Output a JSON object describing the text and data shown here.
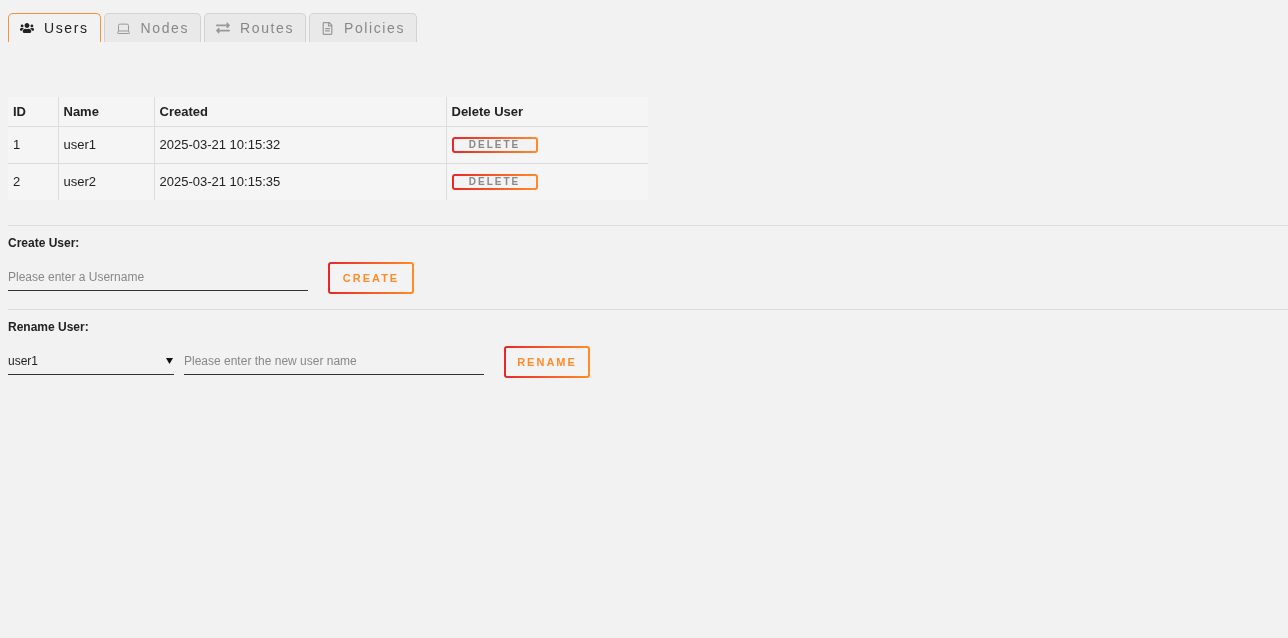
{
  "tabs": [
    {
      "label": "Users",
      "selected": true
    },
    {
      "label": "Nodes",
      "selected": false
    },
    {
      "label": "Routes",
      "selected": false
    },
    {
      "label": "Policies",
      "selected": false
    }
  ],
  "users_table": {
    "columns": [
      "ID",
      "Name",
      "Created",
      "Delete User"
    ],
    "rows": [
      {
        "id": "1",
        "name": "user1",
        "created": "2025-03-21 10:15:32",
        "delete_button": "DELETE"
      },
      {
        "id": "2",
        "name": "user2",
        "created": "2025-03-21 10:15:35",
        "delete_button": "DELETE"
      }
    ]
  },
  "create_user": {
    "label": "Create User:",
    "placeholder": "Please enter a Username",
    "button": "CREATE"
  },
  "rename_user": {
    "label": "Rename User:",
    "select": {
      "value": "user1"
    },
    "placeholder": "Please enter the new user name",
    "button": "RENAME"
  }
}
